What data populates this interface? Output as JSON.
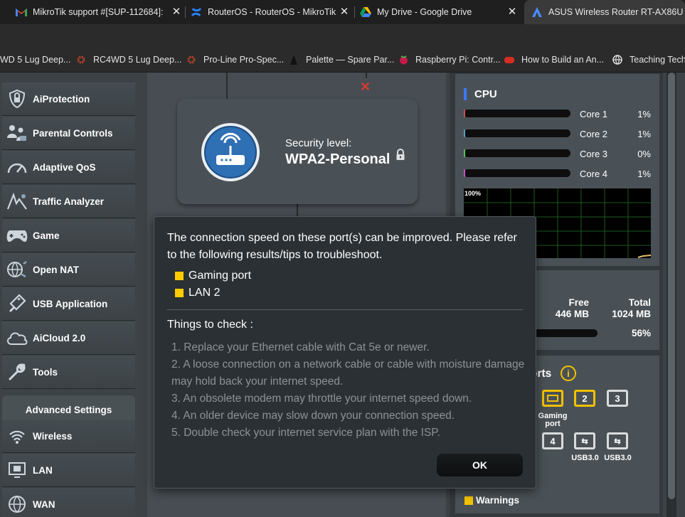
{
  "browser": {
    "tabs": [
      {
        "title": "MikroTik support #[SUP-112684]:",
        "icon": "gmail-icon"
      },
      {
        "title": "RouterOS - RouterOS - MikroTik",
        "icon": "confluence-icon"
      },
      {
        "title": "My Drive - Google Drive",
        "icon": "google-drive-icon"
      },
      {
        "title": "ASUS Wireless Router RT-AX86U",
        "icon": "asus-icon"
      }
    ],
    "bookmarks": [
      {
        "label": "WD 5 Lug Deep..."
      },
      {
        "label": "RC4WD 5 Lug Deep..."
      },
      {
        "label": "Pro-Line Pro-Spec..."
      },
      {
        "label": "Palette — Spare Par..."
      },
      {
        "label": "Raspberry Pi: Contr..."
      },
      {
        "label": "How to Build an An..."
      },
      {
        "label": "Teaching Tech"
      }
    ]
  },
  "menu": {
    "items": [
      {
        "label": "AiProtection",
        "icon": "shield-lock-icon"
      },
      {
        "label": "Parental Controls",
        "icon": "family-icon"
      },
      {
        "label": "Adaptive QoS",
        "icon": "speedometer-icon"
      },
      {
        "label": "Traffic Analyzer",
        "icon": "traffic-analyzer-icon"
      },
      {
        "label": "Game",
        "icon": "gamepad-icon"
      },
      {
        "label": "Open NAT",
        "icon": "globe-network-icon"
      },
      {
        "label": "USB Application",
        "icon": "usb-icon"
      },
      {
        "label": "AiCloud 2.0",
        "icon": "cloud-icon"
      },
      {
        "label": "Tools",
        "icon": "wrench-icon"
      }
    ],
    "advanced_header": "Advanced Settings",
    "advanced_items": [
      {
        "label": "Wireless",
        "icon": "wifi-icon"
      },
      {
        "label": "LAN",
        "icon": "lan-monitor-icon"
      },
      {
        "label": "WAN",
        "icon": "globe-icon"
      }
    ]
  },
  "security": {
    "label": "Security level:",
    "value": "WPA2-Personal"
  },
  "cpu": {
    "title": "CPU",
    "cores": [
      {
        "name": "Core 1",
        "percent": "1%",
        "value": 1
      },
      {
        "name": "Core 2",
        "percent": "1%",
        "value": 1
      },
      {
        "name": "Core 3",
        "percent": "0%",
        "value": 0
      },
      {
        "name": "Core 4",
        "percent": "1%",
        "value": 1
      }
    ],
    "graph_label": "100%"
  },
  "memory": {
    "free_label": "Free",
    "total_label": "Total",
    "free": "446 MB",
    "total": "1024 MB",
    "used_percent": "56%",
    "used_value": 56
  },
  "ports": {
    "title_fragment": "orts",
    "items": [
      {
        "label": "2"
      },
      {
        "label": "3"
      },
      {
        "label": "4"
      }
    ],
    "gaming_label": "Gaming port",
    "usb1": "USB3.0",
    "usb2": "USB3.0",
    "warnings": "Warnings"
  },
  "modal": {
    "message": "The connection speed on these port(s) can be improved. Please refer to the following results/tips to troubleshoot.",
    "ports": [
      "Gaming port",
      "LAN 2"
    ],
    "check_title": "Things to check :",
    "checks": [
      "1. Replace your Ethernet cable with Cat 5e or newer.",
      "2. A loose connection on a network cable or cable with moisture damage may hold back your internet speed.",
      "3. An obsolete modem may throttle your internet speed down.",
      "4. An older device may slow down your connection speed.",
      "5. Double check your internet service plan with the ISP."
    ],
    "ok_label": "OK"
  },
  "colors": {
    "accent": "#3a78ff",
    "port_warning": "#ffcc00",
    "modal_bg": "#2b3034"
  }
}
